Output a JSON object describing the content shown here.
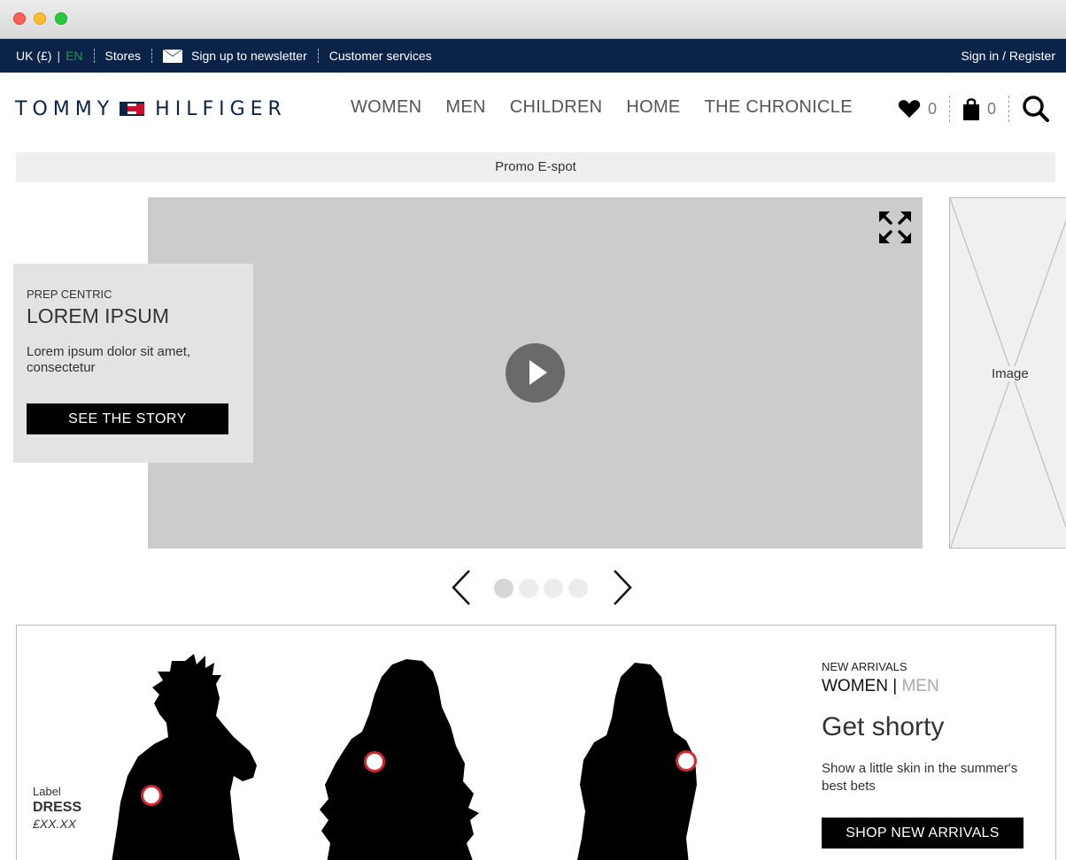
{
  "utility_bar": {
    "region": "UK (£)",
    "language": "EN",
    "stores": "Stores",
    "newsletter": "Sign up to newsletter",
    "customer_services": "Customer services",
    "sign_in": "Sign in / Register",
    "active_language_color": "#1e9b3a",
    "background": "#0b2347"
  },
  "header": {
    "logo_left": "TOMMY",
    "logo_right": "HILFIGER",
    "nav": [
      "WOMEN",
      "MEN",
      "CHILDREN",
      "HOME",
      "THE CHRONICLE"
    ],
    "wishlist_count": "0",
    "bag_count": "0",
    "icons": [
      "heart-icon",
      "shopping-bag-icon",
      "search-icon"
    ]
  },
  "promo": {
    "text": "Promo E-spot"
  },
  "hero": {
    "kicker": "PREP CENTRIC",
    "title": "LOREM IPSUM",
    "description": "Lorem ipsum dolor sit amet, consectetur",
    "cta": "SEE THE STORY",
    "side_image_label": "Image",
    "icons": [
      "expand-icon",
      "play-icon"
    ]
  },
  "carousel": {
    "slides": 4,
    "active_index": 0,
    "icons": [
      "chevron-left-icon",
      "chevron-right-icon"
    ]
  },
  "new_arrivals": {
    "kicker": "NEW ARRIVALS",
    "gender_active": "WOMEN",
    "gender_separator": "|",
    "gender_inactive": "MEN",
    "headline": "Get shorty",
    "description": "Show a little skin in the summer's best bets",
    "cta": "SHOP NEW ARRIVALS",
    "product": {
      "label": "Label",
      "name": "DRESS",
      "price": "£XX.XX"
    },
    "hotspot_color": "#d7262e"
  }
}
